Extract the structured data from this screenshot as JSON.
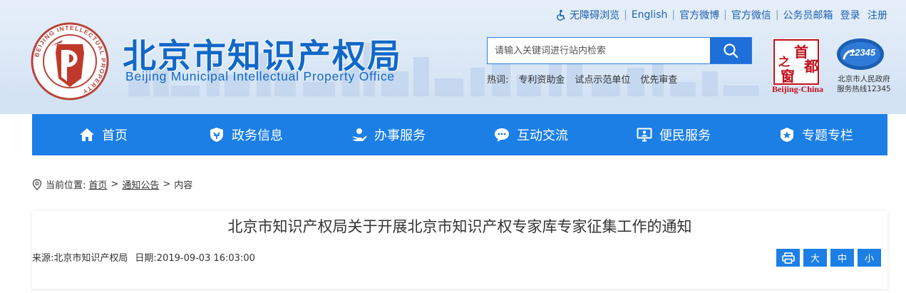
{
  "top_links": {
    "accessibility": "无障碍浏览",
    "english": "English",
    "weibo": "官方微博",
    "wechat": "官方微信",
    "civil_mail": "公务员邮箱",
    "login": "登录",
    "register": "注册"
  },
  "site": {
    "name_cn": "北京市知识产权局",
    "name_en": "Beijing Municipal Intellectual Property Office",
    "emblem_ring_text": "BEIJING INTELLECTUAL PROPERTY"
  },
  "search": {
    "placeholder": "请输入关键词进行站内检索"
  },
  "hotwords": {
    "label": "热词:",
    "items": [
      "专利资助金",
      "试点示范单位",
      "优先审查"
    ]
  },
  "badges": {
    "capital_chars": [
      "首",
      "都",
      "之",
      "窗"
    ],
    "capital_text": "Beijing-China",
    "hotline_number": "12345",
    "hotline_line1": "北京市人民政府",
    "hotline_line2": "服务热线12345"
  },
  "nav": [
    {
      "label": "首页",
      "icon": "home-icon"
    },
    {
      "label": "政务信息",
      "icon": "government-info-icon"
    },
    {
      "label": "办事服务",
      "icon": "service-hand-icon"
    },
    {
      "label": "互动交流",
      "icon": "chat-bubble-icon"
    },
    {
      "label": "便民服务",
      "icon": "monitor-person-icon"
    },
    {
      "label": "专题专栏",
      "icon": "badge-star-icon"
    }
  ],
  "breadcrumb": {
    "prefix": "当前位置:",
    "home": "首页",
    "section": "通知公告",
    "current": "内容",
    "separator": ">"
  },
  "article": {
    "title": "北京市知识产权局关于开展北京市知识产权专家库专家征集工作的通知",
    "source_label": "来源:",
    "source": "北京市知识产权局",
    "date_label": "日期:",
    "date": "2019-09-03 16:03:00"
  },
  "font_tools": {
    "print_icon": "printer-icon",
    "large": "大",
    "medium": "中",
    "small": "小"
  },
  "colors": {
    "brand_blue": "#1c7fe6",
    "title_blue": "#1268c8",
    "capital_red": "#c0101a"
  }
}
